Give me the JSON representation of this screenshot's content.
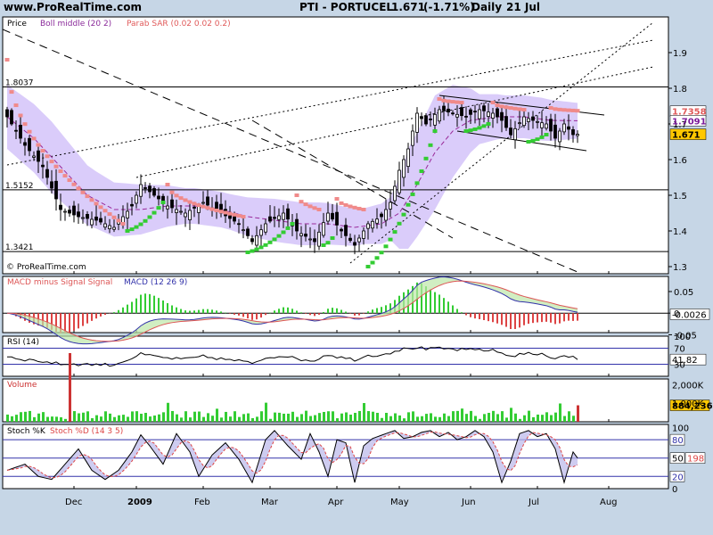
{
  "header": {
    "site": "www.ProRealTime.com",
    "title": "PTI - PORTUCEL",
    "last": "1.671",
    "change": "(-1.71%)",
    "period": "Daily",
    "date": "21 Jul"
  },
  "colors": {
    "background": "#c6d6e6",
    "panel": "#ffffff",
    "bollinger_band": "#d6c6fa",
    "sar_bearish": "#f08a8a",
    "sar_bullish": "#33cc33",
    "macd_line": "#3333aa",
    "signal_line": "#dd5555",
    "volume_bar": "#33cc33",
    "volume_last": "#cc3333"
  },
  "chart_data": [
    {
      "type": "candlestick",
      "panel": "price",
      "legend": [
        "Price",
        "Boll middle (20 2)",
        "Parab SAR (0.02 0.02 0.2)"
      ],
      "watermark": "© ProRealTime.com",
      "ylim": [
        1.28,
        2.0
      ],
      "yticks": [
        1.3,
        1.4,
        1.5,
        1.6,
        1.7,
        1.8,
        1.9
      ],
      "xticks": [
        {
          "label": "Dec",
          "bar": 15
        },
        {
          "label": "2009",
          "bar": 29,
          "bold": true
        },
        {
          "label": "Feb",
          "bar": 44
        },
        {
          "label": "Mar",
          "bar": 59
        },
        {
          "label": "Apr",
          "bar": 74
        },
        {
          "label": "May",
          "bar": 88
        },
        {
          "label": "Jun",
          "bar": 104
        },
        {
          "label": "Jul",
          "bar": 119
        },
        {
          "label": "Aug",
          "bar": 135
        }
      ],
      "levels": [
        {
          "label": "1.8037",
          "value": 1.8037
        },
        {
          "label": "1.5152",
          "value": 1.5152
        },
        {
          "label": "1.3421",
          "value": 1.3421
        }
      ],
      "badges": [
        {
          "label": "1.7358",
          "value": 1.7358,
          "color": "#e05a5a",
          "fill": "#ffffff"
        },
        {
          "label": "1.7091",
          "value": 1.7091,
          "color": "#7a1a9a",
          "fill": "#ffffff"
        },
        {
          "label": "1.671",
          "value": 1.671,
          "color": "#000000",
          "fill": "#ffc800"
        }
      ],
      "close_anchors": [
        [
          0,
          1.72
        ],
        [
          4,
          1.64
        ],
        [
          8,
          1.58
        ],
        [
          12,
          1.46
        ],
        [
          16,
          1.44
        ],
        [
          20,
          1.43
        ],
        [
          24,
          1.41
        ],
        [
          28,
          1.47
        ],
        [
          30,
          1.53
        ],
        [
          33,
          1.5
        ],
        [
          36,
          1.47
        ],
        [
          40,
          1.45
        ],
        [
          44,
          1.48
        ],
        [
          48,
          1.45
        ],
        [
          52,
          1.42
        ],
        [
          55,
          1.37
        ],
        [
          58,
          1.42
        ],
        [
          62,
          1.45
        ],
        [
          65,
          1.4
        ],
        [
          69,
          1.37
        ],
        [
          72,
          1.45
        ],
        [
          75,
          1.4
        ],
        [
          78,
          1.36
        ],
        [
          81,
          1.42
        ],
        [
          84,
          1.44
        ],
        [
          86,
          1.48
        ],
        [
          88,
          1.57
        ],
        [
          90,
          1.63
        ],
        [
          92,
          1.73
        ],
        [
          94,
          1.7
        ],
        [
          97,
          1.74
        ],
        [
          100,
          1.73
        ],
        [
          103,
          1.72
        ],
        [
          106,
          1.74
        ],
        [
          109,
          1.73
        ],
        [
          111,
          1.71
        ],
        [
          113,
          1.67
        ],
        [
          116,
          1.72
        ],
        [
          118,
          1.71
        ],
        [
          121,
          1.7
        ],
        [
          123,
          1.66
        ],
        [
          125,
          1.7
        ],
        [
          127,
          1.67
        ],
        [
          128,
          1.671
        ]
      ],
      "boll_mid_anchors": [
        [
          0,
          1.72
        ],
        [
          6,
          1.66
        ],
        [
          12,
          1.58
        ],
        [
          18,
          1.5
        ],
        [
          24,
          1.46
        ],
        [
          30,
          1.46
        ],
        [
          36,
          1.47
        ],
        [
          42,
          1.47
        ],
        [
          48,
          1.46
        ],
        [
          54,
          1.44
        ],
        [
          60,
          1.43
        ],
        [
          66,
          1.42
        ],
        [
          72,
          1.42
        ],
        [
          78,
          1.41
        ],
        [
          84,
          1.42
        ],
        [
          88,
          1.45
        ],
        [
          92,
          1.53
        ],
        [
          96,
          1.62
        ],
        [
          100,
          1.68
        ],
        [
          104,
          1.71
        ],
        [
          110,
          1.72
        ],
        [
          116,
          1.72
        ],
        [
          122,
          1.71
        ],
        [
          128,
          1.709
        ]
      ],
      "boll_width_anchors": [
        [
          0,
          0.09
        ],
        [
          10,
          0.1
        ],
        [
          20,
          0.08
        ],
        [
          30,
          0.07
        ],
        [
          40,
          0.05
        ],
        [
          50,
          0.05
        ],
        [
          60,
          0.06
        ],
        [
          70,
          0.06
        ],
        [
          80,
          0.05
        ],
        [
          86,
          0.06
        ],
        [
          90,
          0.14
        ],
        [
          96,
          0.16
        ],
        [
          100,
          0.13
        ],
        [
          106,
          0.07
        ],
        [
          112,
          0.06
        ],
        [
          120,
          0.06
        ],
        [
          128,
          0.05
        ]
      ],
      "sar_segments": [
        {
          "trend": "down",
          "from": 0,
          "to": 26,
          "start": 1.88,
          "end": 1.42
        },
        {
          "trend": "up",
          "from": 27,
          "to": 35,
          "start": 1.4,
          "end": 1.48
        },
        {
          "trend": "down",
          "from": 36,
          "to": 53,
          "start": 1.53,
          "end": 1.44
        },
        {
          "trend": "up",
          "from": 54,
          "to": 64,
          "start": 1.34,
          "end": 1.42
        },
        {
          "trend": "down",
          "from": 65,
          "to": 70,
          "start": 1.5,
          "end": 1.46
        },
        {
          "trend": "up",
          "from": 71,
          "to": 73,
          "start": 1.36,
          "end": 1.38
        },
        {
          "trend": "down",
          "from": 74,
          "to": 80,
          "start": 1.49,
          "end": 1.46
        },
        {
          "trend": "up",
          "from": 81,
          "to": 96,
          "start": 1.3,
          "end": 1.68
        },
        {
          "trend": "down",
          "from": 97,
          "to": 102,
          "start": 1.77,
          "end": 1.76
        },
        {
          "trend": "up",
          "from": 103,
          "to": 108,
          "start": 1.68,
          "end": 1.7
        },
        {
          "trend": "down",
          "from": 109,
          "to": 116,
          "start": 1.76,
          "end": 1.74
        },
        {
          "trend": "up",
          "from": 117,
          "to": 121,
          "start": 1.65,
          "end": 1.67
        },
        {
          "trend": "down",
          "from": 122,
          "to": 128,
          "start": 1.745,
          "end": 1.737
        }
      ],
      "trendlines": [
        {
          "style": "dashed",
          "from": [
            -1,
            1.965
          ],
          "to": [
            128,
            1.285
          ]
        },
        {
          "style": "dashed",
          "from": [
            55,
            1.71
          ],
          "to": [
            100,
            1.38
          ]
        },
        {
          "style": "dotted",
          "from": [
            0,
            1.585
          ],
          "to": [
            145,
            1.935
          ]
        },
        {
          "style": "dotted",
          "from": [
            29,
            1.55
          ],
          "to": [
            145,
            1.86
          ]
        },
        {
          "style": "dotted",
          "from": [
            77,
            1.31
          ],
          "to": [
            145,
            1.985
          ]
        },
        {
          "style": "solid",
          "from": [
            97,
            1.78
          ],
          "to": [
            134,
            1.725
          ]
        },
        {
          "style": "solid",
          "from": [
            101,
            1.68
          ],
          "to": [
            130,
            1.625
          ]
        }
      ]
    },
    {
      "type": "macd",
      "panel": "macd",
      "legend": [
        "MACD minus Signal Signal",
        "MACD (12 26 9)"
      ],
      "ylim": [
        -0.045,
        0.085
      ],
      "yticks": [
        {
          "label": "0.05",
          "value": 0.05
        },
        {
          "label": "0",
          "value": 0
        },
        {
          "label": "-0.05",
          "value": -0.05
        }
      ],
      "last_label": "-0.0026",
      "last_value": -0.0026
    },
    {
      "type": "line",
      "panel": "rsi",
      "legend": [
        "RSI (14)"
      ],
      "ylim": [
        0,
        100
      ],
      "yticks": [
        {
          "label": "100",
          "value": 100
        },
        {
          "label": "70",
          "value": 70
        },
        {
          "label": "30",
          "value": 30
        }
      ],
      "last_label": "41.82",
      "last_value": 41.82
    },
    {
      "type": "bar",
      "panel": "volume",
      "legend": [
        "Volume"
      ],
      "ylim": [
        0,
        2300000
      ],
      "yticks": [
        {
          "label": "2,000K",
          "value": 2000000
        },
        {
          "label": "1,000K",
          "value": 1000000
        }
      ],
      "last_label": "884,236",
      "last_value": 884236
    },
    {
      "type": "line",
      "panel": "stochastic",
      "legend": [
        "Stoch %K",
        "Stoch %D (14 3 5)"
      ],
      "ylim": [
        0,
        105
      ],
      "yticks": [
        {
          "label": "100",
          "value": 100
        },
        {
          "label": "80",
          "value": 80
        },
        {
          "label": "50",
          "value": 50
        },
        {
          "label": "20",
          "value": 20
        },
        {
          "label": "0",
          "value": 0
        }
      ],
      "k_label": "50",
      "k_value": 50,
      "d_label": "198",
      "k_anchors": [
        [
          0,
          30
        ],
        [
          4,
          40
        ],
        [
          7,
          20
        ],
        [
          10,
          15
        ],
        [
          13,
          40
        ],
        [
          16,
          65
        ],
        [
          19,
          30
        ],
        [
          22,
          15
        ],
        [
          25,
          30
        ],
        [
          28,
          60
        ],
        [
          30,
          88
        ],
        [
          32,
          70
        ],
        [
          35,
          40
        ],
        [
          38,
          90
        ],
        [
          41,
          60
        ],
        [
          43,
          20
        ],
        [
          46,
          55
        ],
        [
          49,
          75
        ],
        [
          52,
          48
        ],
        [
          55,
          10
        ],
        [
          58,
          80
        ],
        [
          60,
          95
        ],
        [
          63,
          70
        ],
        [
          66,
          48
        ],
        [
          68,
          90
        ],
        [
          70,
          60
        ],
        [
          72,
          20
        ],
        [
          74,
          80
        ],
        [
          76,
          75
        ],
        [
          78,
          10
        ],
        [
          80,
          70
        ],
        [
          82,
          82
        ],
        [
          85,
          90
        ],
        [
          87,
          95
        ],
        [
          89,
          82
        ],
        [
          91,
          85
        ],
        [
          93,
          92
        ],
        [
          95,
          95
        ],
        [
          97,
          85
        ],
        [
          99,
          92
        ],
        [
          101,
          80
        ],
        [
          103,
          85
        ],
        [
          105,
          95
        ],
        [
          107,
          85
        ],
        [
          109,
          60
        ],
        [
          111,
          10
        ],
        [
          113,
          45
        ],
        [
          115,
          90
        ],
        [
          117,
          95
        ],
        [
          119,
          85
        ],
        [
          121,
          90
        ],
        [
          123,
          65
        ],
        [
          125,
          10
        ],
        [
          127,
          60
        ],
        [
          128,
          50
        ]
      ]
    }
  ]
}
